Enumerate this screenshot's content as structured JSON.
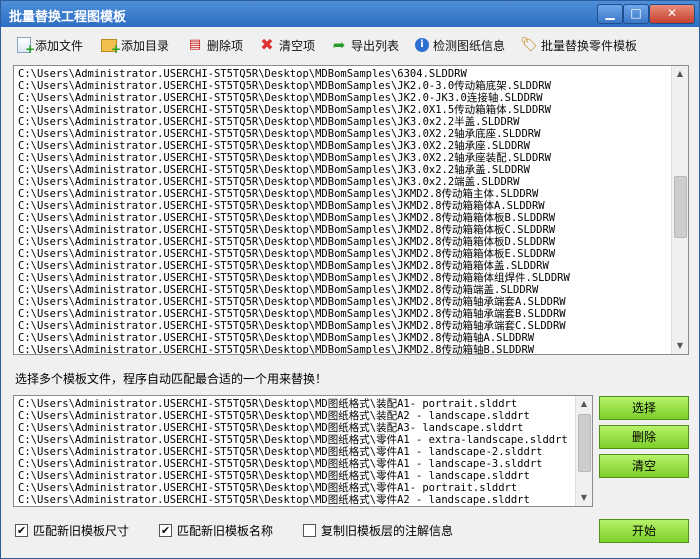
{
  "window": {
    "title": "批量替换工程图模板",
    "controls": {
      "minimize": "▁",
      "maximize": "□",
      "close": "✕"
    }
  },
  "toolbar": {
    "add_file": "添加文件",
    "add_dir": "添加目录",
    "delete_item": "删除项",
    "clear_items": "清空项",
    "export_list": "导出列表",
    "check_info": "检测图纸信息",
    "batch_replace_part": "批量替换零件模板"
  },
  "files_list": [
    "C:\\Users\\Administrator.USERCHI-ST5TQ5R\\Desktop\\MDBomSamples\\6304.SLDDRW",
    "C:\\Users\\Administrator.USERCHI-ST5TQ5R\\Desktop\\MDBomSamples\\JK2.0-3.0传动箱底架.SLDDRW",
    "C:\\Users\\Administrator.USERCHI-ST5TQ5R\\Desktop\\MDBomSamples\\JK2.0-JK3.0连接轴.SLDDRW",
    "C:\\Users\\Administrator.USERCHI-ST5TQ5R\\Desktop\\MDBomSamples\\JK2.0X1.5传动箱箱体.SLDDRW",
    "C:\\Users\\Administrator.USERCHI-ST5TQ5R\\Desktop\\MDBomSamples\\JK3.0x2.2半盖.SLDDRW",
    "C:\\Users\\Administrator.USERCHI-ST5TQ5R\\Desktop\\MDBomSamples\\JK3.0X2.2轴承底座.SLDDRW",
    "C:\\Users\\Administrator.USERCHI-ST5TQ5R\\Desktop\\MDBomSamples\\JK3.0X2.2轴承座.SLDDRW",
    "C:\\Users\\Administrator.USERCHI-ST5TQ5R\\Desktop\\MDBomSamples\\JK3.0X2.2轴承座装配.SLDDRW",
    "C:\\Users\\Administrator.USERCHI-ST5TQ5R\\Desktop\\MDBomSamples\\JK3.0x2.2轴承盖.SLDDRW",
    "C:\\Users\\Administrator.USERCHI-ST5TQ5R\\Desktop\\MDBomSamples\\JK3.0x2.2端盖.SLDDRW",
    "C:\\Users\\Administrator.USERCHI-ST5TQ5R\\Desktop\\MDBomSamples\\JKMD2.8传动箱主体.SLDDRW",
    "C:\\Users\\Administrator.USERCHI-ST5TQ5R\\Desktop\\MDBomSamples\\JKMD2.8传动箱箱体A.SLDDRW",
    "C:\\Users\\Administrator.USERCHI-ST5TQ5R\\Desktop\\MDBomSamples\\JKMD2.8传动箱箱体板B.SLDDRW",
    "C:\\Users\\Administrator.USERCHI-ST5TQ5R\\Desktop\\MDBomSamples\\JKMD2.8传动箱箱体板C.SLDDRW",
    "C:\\Users\\Administrator.USERCHI-ST5TQ5R\\Desktop\\MDBomSamples\\JKMD2.8传动箱箱体板D.SLDDRW",
    "C:\\Users\\Administrator.USERCHI-ST5TQ5R\\Desktop\\MDBomSamples\\JKMD2.8传动箱箱体板E.SLDDRW",
    "C:\\Users\\Administrator.USERCHI-ST5TQ5R\\Desktop\\MDBomSamples\\JKMD2.8传动箱箱体盖.SLDDRW",
    "C:\\Users\\Administrator.USERCHI-ST5TQ5R\\Desktop\\MDBomSamples\\JKMD2.8传动箱箱体组焊件.SLDDRW",
    "C:\\Users\\Administrator.USERCHI-ST5TQ5R\\Desktop\\MDBomSamples\\JKMD2.8传动箱端盖.SLDDRW",
    "C:\\Users\\Administrator.USERCHI-ST5TQ5R\\Desktop\\MDBomSamples\\JKMD2.8传动箱轴承端套A.SLDDRW",
    "C:\\Users\\Administrator.USERCHI-ST5TQ5R\\Desktop\\MDBomSamples\\JKMD2.8传动箱轴承端套B.SLDDRW",
    "C:\\Users\\Administrator.USERCHI-ST5TQ5R\\Desktop\\MDBomSamples\\JKMD2.8传动箱轴承端套C.SLDDRW",
    "C:\\Users\\Administrator.USERCHI-ST5TQ5R\\Desktop\\MDBomSamples\\JKMD2.8传动箱轴A.SLDDRW",
    "C:\\Users\\Administrator.USERCHI-ST5TQ5R\\Desktop\\MDBomSamples\\JKMD2.8传动箱轴B.SLDDRW"
  ],
  "templates_label": "选择多个模板文件，程序自动匹配最合适的一个用来替换！",
  "templates_list": [
    "C:\\Users\\Administrator.USERCHI-ST5TQ5R\\Desktop\\MD图纸格式\\装配A1- portrait.slddrt",
    "C:\\Users\\Administrator.USERCHI-ST5TQ5R\\Desktop\\MD图纸格式\\装配A2 - landscape.slddrt",
    "C:\\Users\\Administrator.USERCHI-ST5TQ5R\\Desktop\\MD图纸格式\\装配A3- landscape.slddrt",
    "C:\\Users\\Administrator.USERCHI-ST5TQ5R\\Desktop\\MD图纸格式\\零件A1 - extra-landscape.slddrt",
    "C:\\Users\\Administrator.USERCHI-ST5TQ5R\\Desktop\\MD图纸格式\\零件A1 - landscape-2.slddrt",
    "C:\\Users\\Administrator.USERCHI-ST5TQ5R\\Desktop\\MD图纸格式\\零件A1 - landscape-3.slddrt",
    "C:\\Users\\Administrator.USERCHI-ST5TQ5R\\Desktop\\MD图纸格式\\零件A1 - landscape.slddrt",
    "C:\\Users\\Administrator.USERCHI-ST5TQ5R\\Desktop\\MD图纸格式\\零件A1- portrait.slddrt",
    "C:\\Users\\Administrator.USERCHI-ST5TQ5R\\Desktop\\MD图纸格式\\零件A2 - landscape.slddrt"
  ],
  "side_buttons": {
    "select": "选择",
    "delete": "删除",
    "clear": "清空"
  },
  "options": {
    "match_size": {
      "label": "匹配新旧模板尺寸",
      "checked": true
    },
    "match_name": {
      "label": "匹配新旧模板名称",
      "checked": true
    },
    "copy_notes": {
      "label": "复制旧模板层的注解信息",
      "checked": false
    }
  },
  "start_button": "开始"
}
